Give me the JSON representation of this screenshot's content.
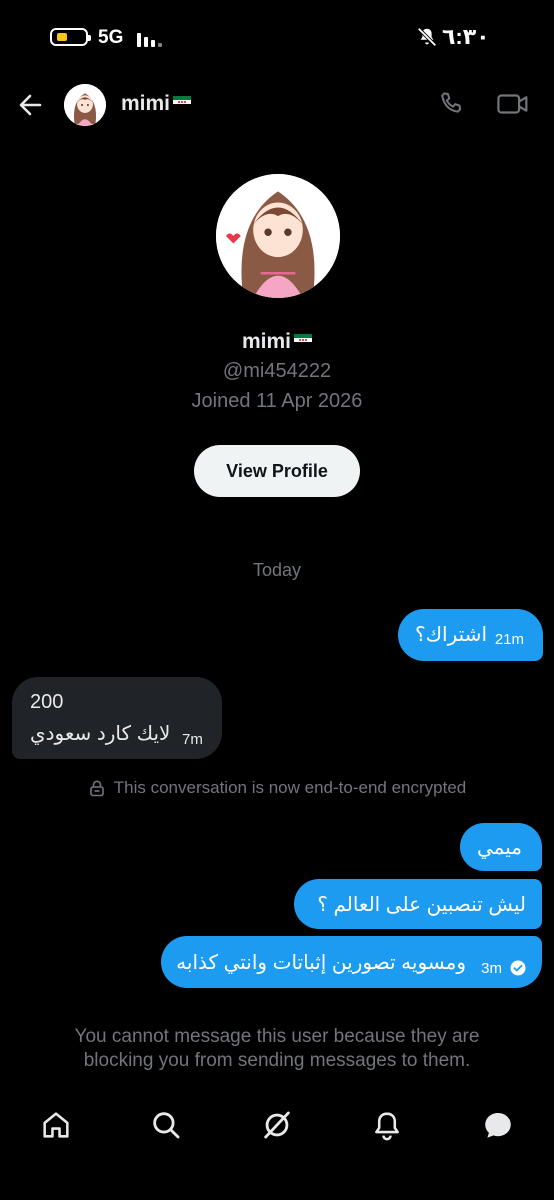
{
  "status_bar": {
    "network": "5G",
    "time": "٦:٣٠"
  },
  "header": {
    "name": "mimi"
  },
  "profile": {
    "name": "mimi",
    "handle": "@mi454222",
    "joined": "Joined 11 Apr 2026",
    "view_profile_label": "View Profile"
  },
  "conversation": {
    "date_divider": "Today",
    "messages": [
      {
        "direction": "outgoing",
        "text": "اشتراك؟",
        "time": "21m"
      },
      {
        "direction": "incoming",
        "line1": "200",
        "line2": "لايك كارد سعودي",
        "time": "7m"
      },
      {
        "direction": "outgoing",
        "text": "ميمي"
      },
      {
        "direction": "outgoing",
        "text": "ليش تنصبين على العالم ؟"
      },
      {
        "direction": "outgoing",
        "text": "ومسويه تصورين إثباتات وانتي كذابه",
        "time": "3m",
        "status": "seen-check-icon"
      }
    ],
    "encrypted_notice": "This conversation is now end-to-end encrypted",
    "blocked_notice": "You cannot message this user because they are blocking you from sending messages to them."
  },
  "tab_bar": [
    "home-icon",
    "search-icon",
    "grok-icon",
    "notifications-icon",
    "messages-icon"
  ],
  "colors": {
    "accent": "#1d9bf0",
    "background": "#000000",
    "incoming_bubble": "#202327",
    "muted_text": "#71767b"
  }
}
